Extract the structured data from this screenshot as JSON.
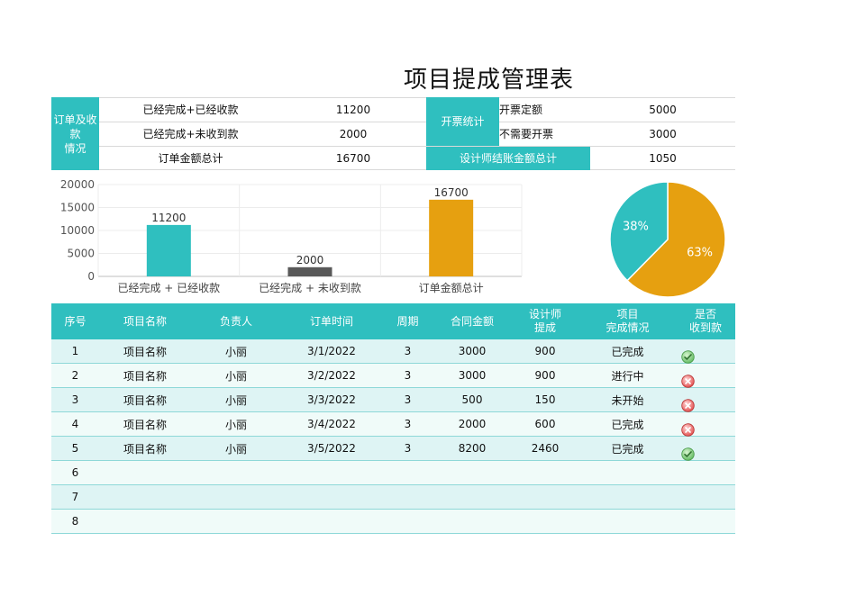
{
  "title": "项目提成管理表",
  "summary": {
    "order_group_label": "订单及收\n款\n情况",
    "orders": [
      {
        "label": "已经完成+已经收款",
        "value": "11200"
      },
      {
        "label": "已经完成+未收到款",
        "value": "2000"
      },
      {
        "label": "订单金额总计",
        "value": "16700"
      }
    ],
    "invoice_group_label": "开票统计",
    "invoices": [
      {
        "label": "开票定额",
        "value": "5000"
      },
      {
        "label": "不需要开票",
        "value": "3000"
      }
    ],
    "designer_total_label": "设计师结账金额总计",
    "designer_total_value": "1050"
  },
  "chart_data": [
    {
      "type": "bar",
      "categories": [
        "已经完成 + 已经收款",
        "已经完成 + 未收到款",
        "订单金额总计"
      ],
      "values": [
        11200,
        2000,
        16700
      ],
      "colors": [
        "#2fbfbf",
        "#595959",
        "#e6a010"
      ],
      "ylim": [
        0,
        20000
      ],
      "yticks": [
        0,
        5000,
        10000,
        15000,
        20000
      ],
      "grid": true
    },
    {
      "type": "pie",
      "labels": [
        "38%",
        "63%"
      ],
      "values": [
        38,
        63
      ],
      "colors": [
        "#2fbfbf",
        "#e6a010"
      ]
    }
  ],
  "table": {
    "headers": [
      "序号",
      "项目名称",
      "负责人",
      "订单时间",
      "周期",
      "合同金额",
      "设计师\n提成",
      "项目\n完成情况",
      "是否\n收到款"
    ],
    "rows": [
      {
        "no": "1",
        "name": "项目名称",
        "owner": "小丽",
        "date": "3/1/2022",
        "period": "3",
        "amount": "3000",
        "commission": "900",
        "status": "已完成",
        "paid": "check"
      },
      {
        "no": "2",
        "name": "项目名称",
        "owner": "小丽",
        "date": "3/2/2022",
        "period": "3",
        "amount": "3000",
        "commission": "900",
        "status": "进行中",
        "paid": "cross"
      },
      {
        "no": "3",
        "name": "项目名称",
        "owner": "小丽",
        "date": "3/3/2022",
        "period": "3",
        "amount": "500",
        "commission": "150",
        "status": "未开始",
        "paid": "cross"
      },
      {
        "no": "4",
        "name": "项目名称",
        "owner": "小丽",
        "date": "3/4/2022",
        "period": "3",
        "amount": "2000",
        "commission": "600",
        "status": "已完成",
        "paid": "cross"
      },
      {
        "no": "5",
        "name": "项目名称",
        "owner": "小丽",
        "date": "3/5/2022",
        "period": "3",
        "amount": "8200",
        "commission": "2460",
        "status": "已完成",
        "paid": "check"
      },
      {
        "no": "6",
        "name": "",
        "owner": "",
        "date": "",
        "period": "",
        "amount": "",
        "commission": "",
        "status": "",
        "paid": ""
      },
      {
        "no": "7",
        "name": "",
        "owner": "",
        "date": "",
        "period": "",
        "amount": "",
        "commission": "",
        "status": "",
        "paid": ""
      },
      {
        "no": "8",
        "name": "",
        "owner": "",
        "date": "",
        "period": "",
        "amount": "",
        "commission": "",
        "status": "",
        "paid": ""
      }
    ]
  }
}
